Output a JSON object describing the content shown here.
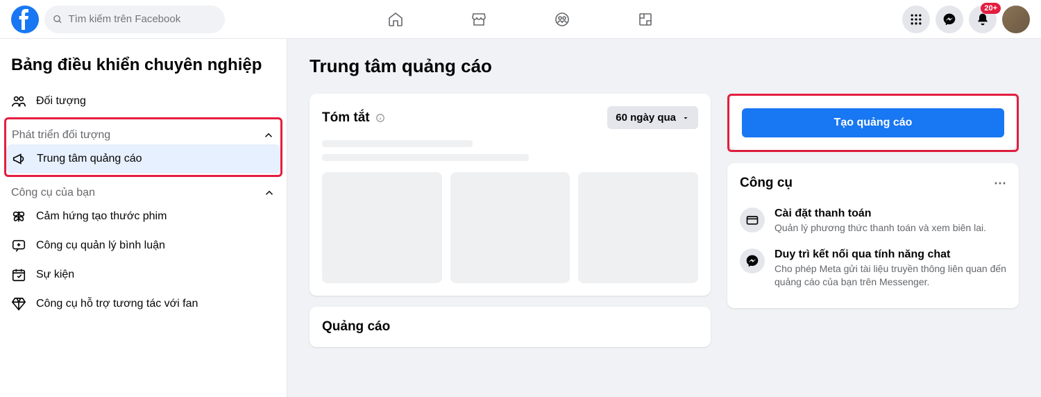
{
  "header": {
    "search_placeholder": "Tìm kiếm trên Facebook",
    "notification_badge": "20+"
  },
  "sidebar": {
    "title": "Bảng điều khiển chuyên nghiệp",
    "audience_label": "Đối tượng",
    "section_grow": "Phát triển đối tượng",
    "ad_center_label": "Trung tâm quảng cáo",
    "section_tools": "Công cụ của bạn",
    "items": {
      "inspiration": "Cảm hứng tạo thước phim",
      "comments": "Công cụ quản lý bình luận",
      "events": "Sự kiện",
      "fan_tools": "Công cụ hỗ trợ tương tác với fan"
    }
  },
  "main": {
    "title": "Trung tâm quảng cáo",
    "summary": {
      "title": "Tóm tắt",
      "range": "60 ngày qua"
    },
    "ads_title": "Quảng cáo",
    "create_ad_button": "Tạo quảng cáo",
    "tools": {
      "title": "Công cụ",
      "payment": {
        "label": "Cài đặt thanh toán",
        "desc": "Quản lý phương thức thanh toán và xem biên lai."
      },
      "chat": {
        "label": "Duy trì kết nối qua tính năng chat",
        "desc": "Cho phép Meta gửi tài liệu truyền thông liên quan đến quảng cáo của bạn trên Messenger."
      }
    }
  }
}
